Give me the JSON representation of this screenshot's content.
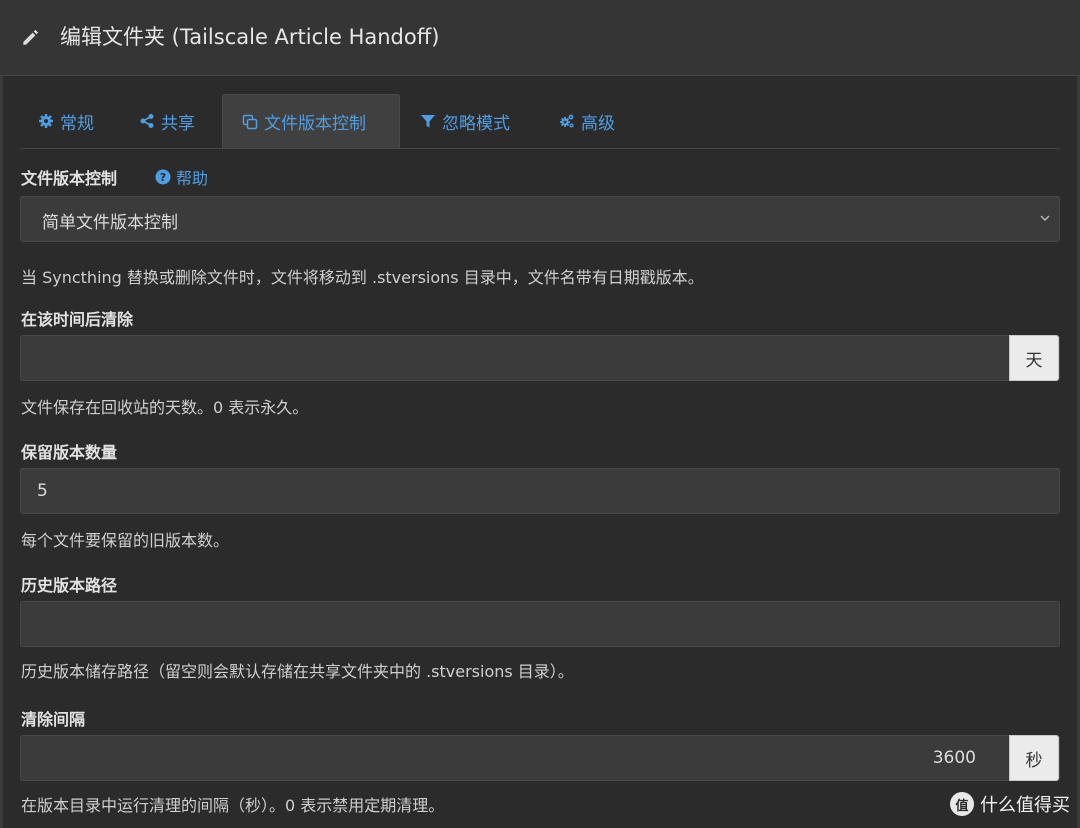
{
  "dialog": {
    "title": "编辑文件夹 (Tailscale Article Handoff)"
  },
  "tabs": [
    {
      "label": "常规",
      "icon": "gear-icon"
    },
    {
      "label": "共享",
      "icon": "share-icon"
    },
    {
      "label": "文件版本控制",
      "icon": "copy-icon",
      "active": true
    },
    {
      "label": "忽略模式",
      "icon": "filter-icon"
    },
    {
      "label": "高级",
      "icon": "cogs-icon"
    }
  ],
  "versioning": {
    "label": "文件版本控制",
    "help_link": "帮助",
    "selected": "简单文件版本控制",
    "description": "当 Syncthing 替换或删除文件时，文件将移动到 .stversions 目录中，文件名带有日期戳版本。"
  },
  "cleanout_after": {
    "label": "在该时间后清除",
    "value": "",
    "unit": "天",
    "help": "文件保存在回收站的天数。0 表示永久。"
  },
  "keep_versions": {
    "label": "保留版本数量",
    "value": "5",
    "help": "每个文件要保留的旧版本数。"
  },
  "versions_path": {
    "label": "历史版本路径",
    "value": "",
    "help": "历史版本储存路径（留空则会默认存储在共享文件夹中的 .stversions 目录）。"
  },
  "cleanup_interval": {
    "label": "清除间隔",
    "value": "3600",
    "unit": "秒",
    "help": "在版本目录中运行清理的间隔（秒）。0 表示禁用定期清理。"
  },
  "watermark": {
    "logo": "值",
    "text": "什么值得买"
  },
  "colors": {
    "accent": "#4f9de3",
    "background": "#2b2b2b",
    "input_bg": "#3b3b3b"
  }
}
